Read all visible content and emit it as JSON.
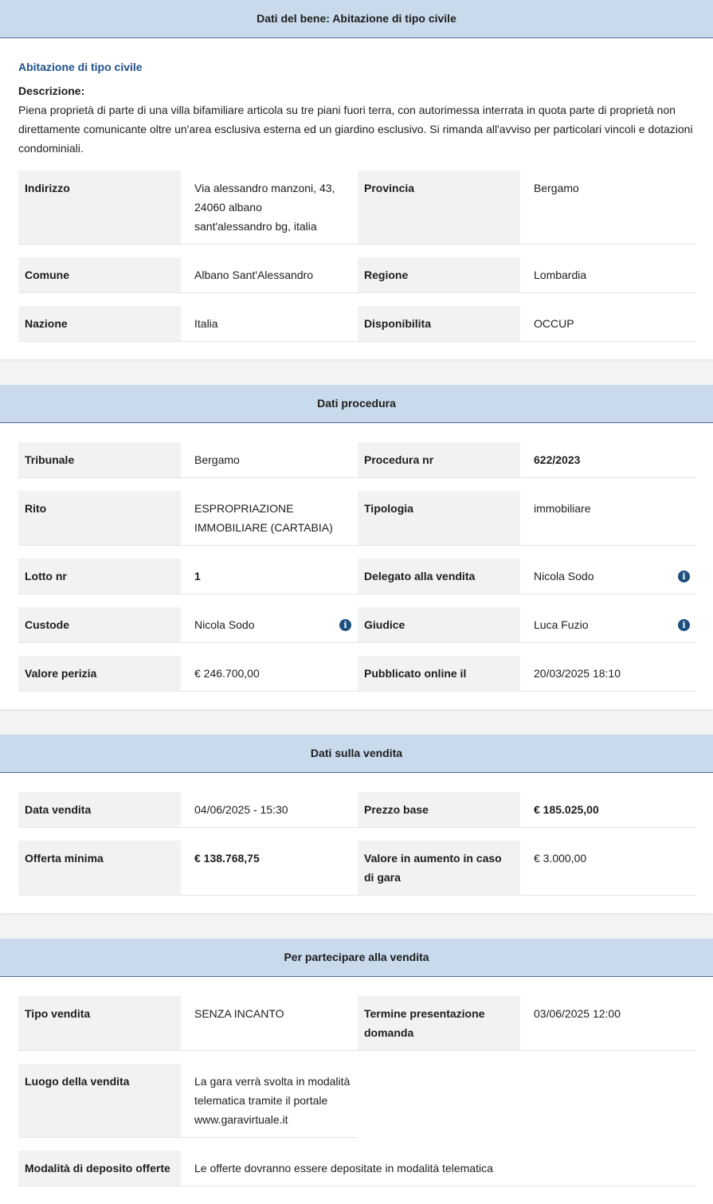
{
  "bene": {
    "header": "Dati del bene: Abitazione di tipo civile",
    "subtitle": "Abitazione di tipo civile",
    "desc_label": "Descrizione:",
    "desc_text": "Piena proprietà di parte di una villa bifamiliare articola su tre piani fuori terra, con autorimessa interrata in quota parte di proprietà non direttamente comunicante oltre un'area esclusiva esterna ed un giardino esclusivo. Si rimanda all'avviso per particolari vincoli e dotazioni condominiali.",
    "rows": [
      {
        "l1": "Indirizzo",
        "v1": "Via alessandro manzoni, 43,\n24060 albano\nsant'alessandro bg, italia",
        "l2": "Provincia",
        "v2": "Bergamo"
      },
      {
        "l1": "Comune",
        "v1": "Albano Sant'Alessandro",
        "l2": "Regione",
        "v2": "Lombardia"
      },
      {
        "l1": "Nazione",
        "v1": "Italia",
        "l2": "Disponibilita",
        "v2": "OCCUP"
      }
    ]
  },
  "procedura": {
    "header": "Dati procedura",
    "rows": [
      {
        "l1": "Tribunale",
        "v1": "Bergamo",
        "l2": "Procedura nr",
        "v2": "622/2023"
      },
      {
        "l1": "Rito",
        "v1": "ESPROPRIAZIONE\nIMMOBILIARE (CARTABIA)",
        "l2": "Tipologia",
        "v2": "immobiliare"
      },
      {
        "l1": "Lotto nr",
        "v1": "1",
        "l2": "Delegato alla vendita",
        "v2": "Nicola Sodo"
      },
      {
        "l1": "Custode",
        "v1": "Nicola Sodo",
        "l2": "Giudice",
        "v2": "Luca Fuzio"
      },
      {
        "l1": "Valore perizia",
        "v1": "€ 246.700,00",
        "l2": "Pubblicato online il",
        "v2": "20/03/2025 18:10"
      }
    ]
  },
  "vendita": {
    "header": "Dati sulla vendita",
    "rows": [
      {
        "l1": "Data vendita",
        "v1": "04/06/2025 - 15:30",
        "l2": "Prezzo base",
        "v2": "€ 185.025,00"
      },
      {
        "l1": "Offerta minima",
        "v1": "€ 138.768,75",
        "l2": "Valore in aumento in caso di gara",
        "v2": "€ 3.000,00"
      }
    ]
  },
  "partecipare": {
    "header": "Per partecipare alla vendita",
    "rows": [
      {
        "l1": "Tipo vendita",
        "v1": "SENZA INCANTO",
        "l2": "Termine presentazione domanda",
        "v2": "03/06/2025 12:00"
      },
      {
        "l1": "Luogo della vendita",
        "v1": "La gara verrà svolta in modalità telematica tramite il portale www.garavirtuale.it"
      },
      {
        "l1": "Modalità di deposito offerte",
        "v1": "Le offerte dovranno essere depositate in modalità telematica"
      }
    ]
  },
  "icons": {
    "info": "i"
  }
}
